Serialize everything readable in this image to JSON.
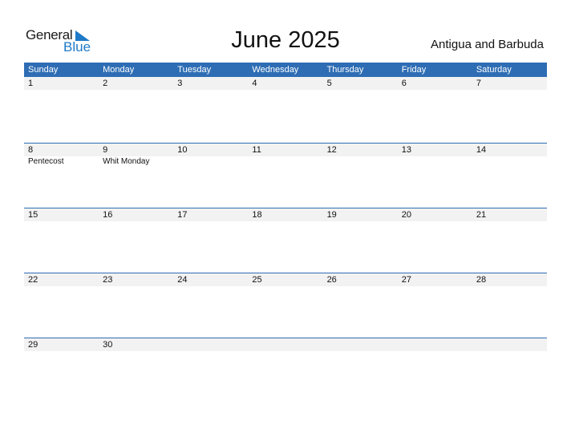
{
  "logo": {
    "general": "General",
    "blue": "Blue"
  },
  "title": "June 2025",
  "country": "Antigua and Barbuda",
  "colors": {
    "header": "#2e6db4",
    "logo_blue": "#1e7ac8",
    "day_band": "#f2f2f2"
  },
  "weekdays": [
    "Sunday",
    "Monday",
    "Tuesday",
    "Wednesday",
    "Thursday",
    "Friday",
    "Saturday"
  ],
  "weeks": [
    {
      "days": [
        "1",
        "2",
        "3",
        "4",
        "5",
        "6",
        "7"
      ],
      "events": [
        "",
        "",
        "",
        "",
        "",
        "",
        ""
      ]
    },
    {
      "days": [
        "8",
        "9",
        "10",
        "11",
        "12",
        "13",
        "14"
      ],
      "events": [
        "Pentecost",
        "Whit Monday",
        "",
        "",
        "",
        "",
        ""
      ]
    },
    {
      "days": [
        "15",
        "16",
        "17",
        "18",
        "19",
        "20",
        "21"
      ],
      "events": [
        "",
        "",
        "",
        "",
        "",
        "",
        ""
      ]
    },
    {
      "days": [
        "22",
        "23",
        "24",
        "25",
        "26",
        "27",
        "28"
      ],
      "events": [
        "",
        "",
        "",
        "",
        "",
        "",
        ""
      ]
    },
    {
      "days": [
        "29",
        "30",
        "",
        "",
        "",
        "",
        ""
      ],
      "events": [
        "",
        "",
        "",
        "",
        "",
        "",
        ""
      ]
    }
  ]
}
